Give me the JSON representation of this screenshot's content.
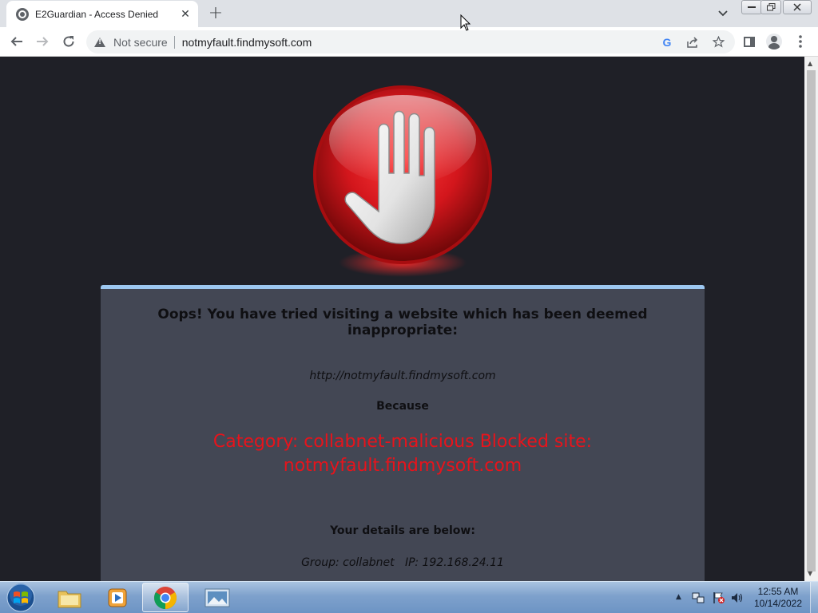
{
  "browser": {
    "tab_title": "E2Guardian - Access Denied",
    "security_label": "Not secure",
    "url": "notmyfault.findmysoft.com"
  },
  "page": {
    "headline": "Oops! You have tried visiting a website which has been deemed inappropriate:",
    "blocked_url": "http://notmyfault.findmysoft.com",
    "because_label": "Because",
    "reason": "Category: collabnet-malicious  Blocked site: notmyfault.findmysoft.com",
    "details_header": "Your details are below:",
    "details": "Group: collabnet   IP: 192.168.24.11",
    "colors": {
      "background": "#1f2027",
      "panel": "#434754",
      "panel_top_border": "#9dc7f0",
      "reason_text": "#e8131b",
      "stop_sign": "#d3161c"
    }
  },
  "taskbar": {
    "apps": [
      "windows-explorer",
      "media-player",
      "google-chrome",
      "image-viewer"
    ],
    "active_app": "google-chrome",
    "clock_time": "12:55 AM",
    "clock_date": "10/14/2022"
  }
}
